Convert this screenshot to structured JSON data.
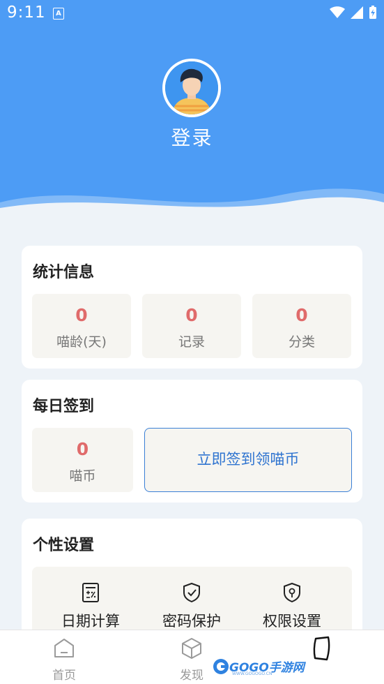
{
  "status_bar": {
    "time": "9:11",
    "badge": "A"
  },
  "profile": {
    "login_label": "登录"
  },
  "stats": {
    "title": "统计信息",
    "items": [
      {
        "value": "0",
        "label": "喵龄(天)"
      },
      {
        "value": "0",
        "label": "记录"
      },
      {
        "value": "0",
        "label": "分类"
      }
    ]
  },
  "checkin": {
    "title": "每日签到",
    "coins": {
      "value": "0",
      "label": "喵币"
    },
    "button_label": "立即签到领喵币"
  },
  "settings": {
    "title": "个性设置",
    "items": [
      {
        "label": "日期计算",
        "icon": "calculator-icon"
      },
      {
        "label": "密码保护",
        "icon": "shield-check-icon"
      },
      {
        "label": "权限设置",
        "icon": "shield-lock-icon"
      }
    ]
  },
  "tabbar": {
    "items": [
      {
        "label": "首页",
        "icon": "home-icon"
      },
      {
        "label": "发现",
        "icon": "cube-icon"
      }
    ]
  },
  "watermark": {
    "text": "GOGO手游网",
    "sub": "WWW.GOGOGO.CN"
  },
  "colors": {
    "header": "#4d9cf5",
    "accent": "#2f74d0",
    "stat_value": "#e06b6b"
  }
}
